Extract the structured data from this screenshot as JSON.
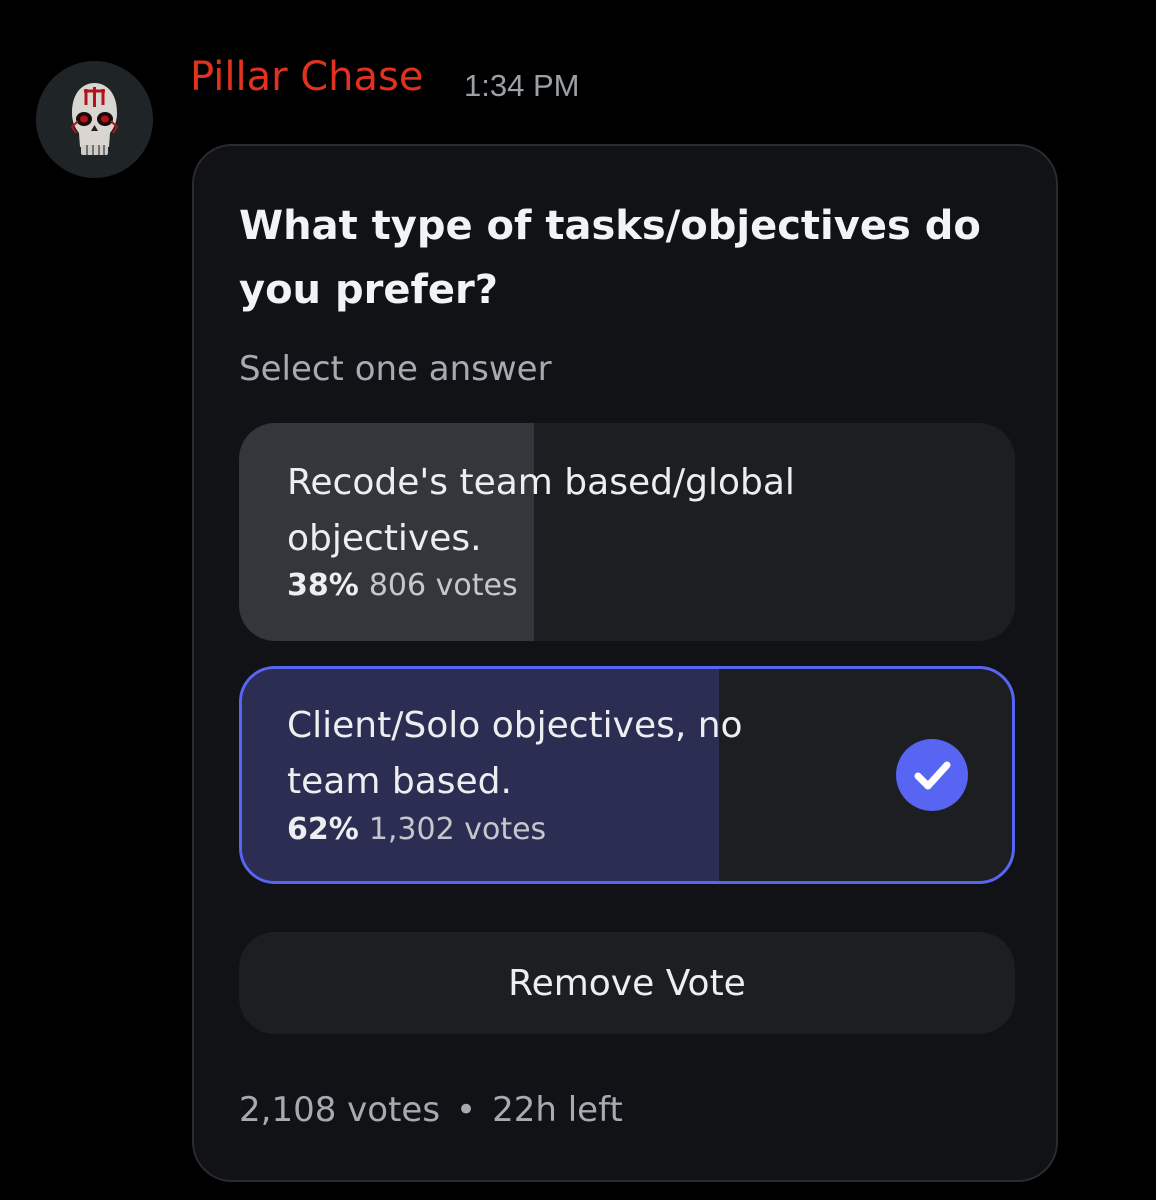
{
  "message": {
    "author": "Pillar Chase",
    "timestamp": "1:34 PM",
    "author_color": "#e0321f",
    "avatar_icon": "skull-avatar"
  },
  "poll": {
    "question": "What type of tasks/objectives do you prefer?",
    "subtitle": "Select one answer",
    "accent_color": "#5865f2",
    "answers": [
      {
        "text": "Recode's team based/global objectives.",
        "percent_label": "38%",
        "percent": 38,
        "votes_label": "806 votes",
        "selected": false
      },
      {
        "text": "Client/Solo objectives, no team based.",
        "percent_label": "62%",
        "percent": 62,
        "votes_label": "1,302 votes",
        "selected": true,
        "selected_icon": "checkmark-icon"
      }
    ],
    "remove_vote_label": "Remove Vote",
    "total_votes": "2,108 votes",
    "separator": "•",
    "time_left": "22h left"
  }
}
